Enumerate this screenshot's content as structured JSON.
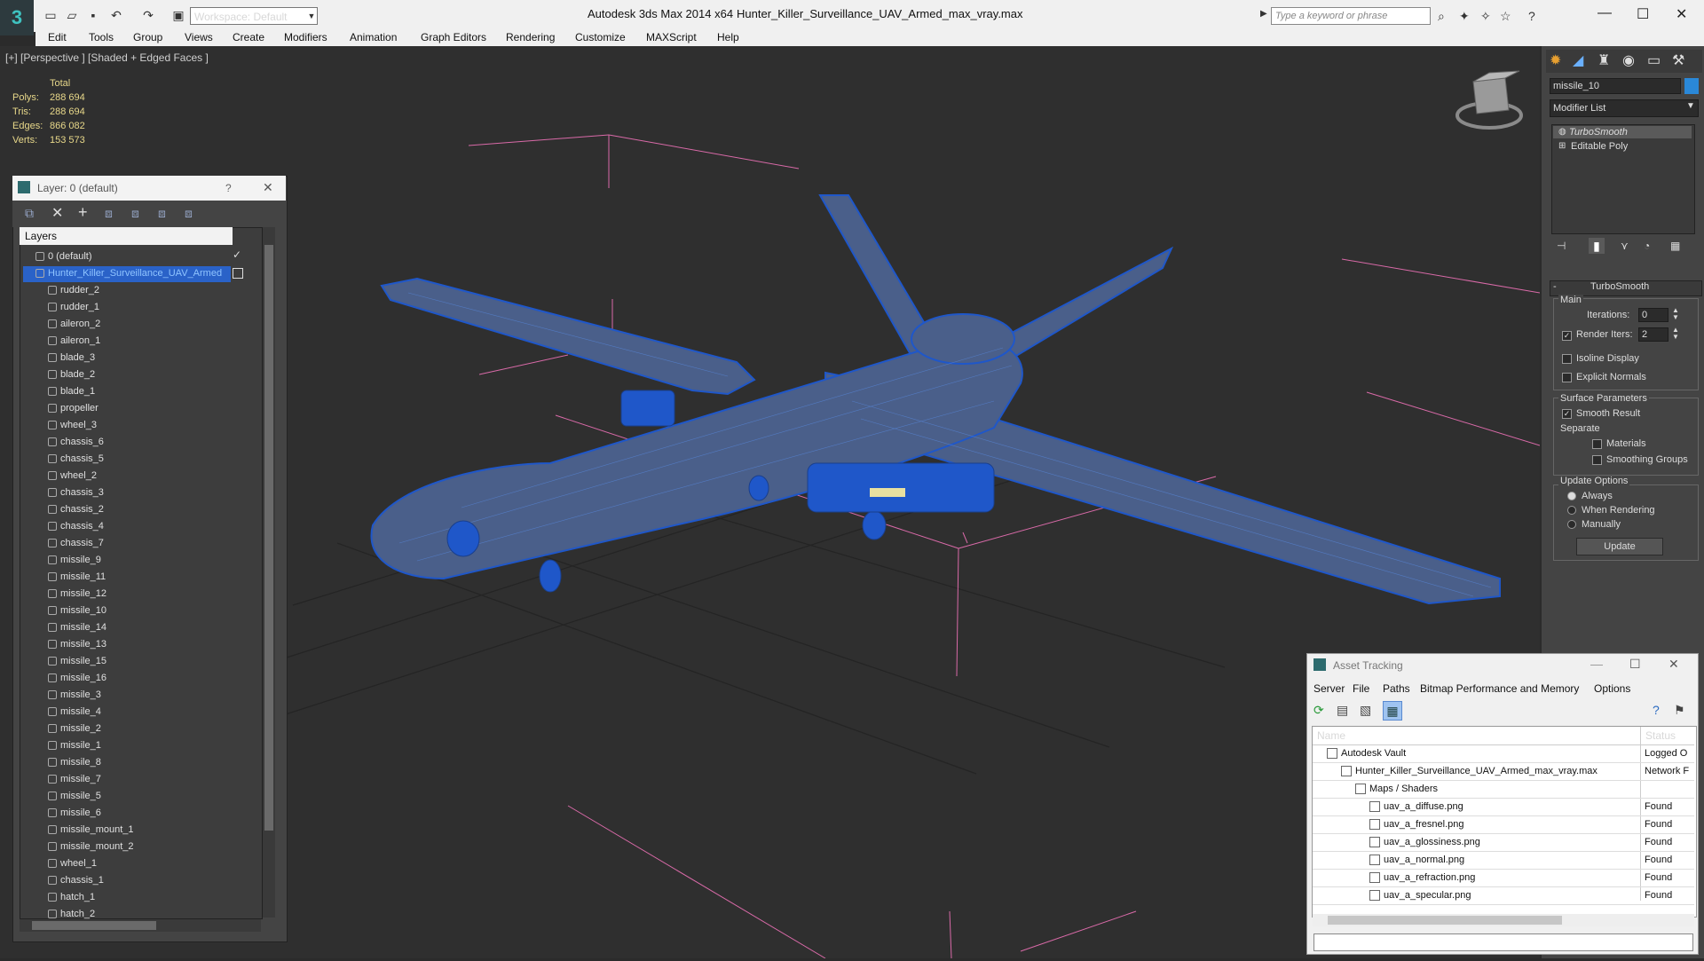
{
  "titlebar": {
    "workspace": "Workspace: Default",
    "app": "Autodesk 3ds Max  2014 x64",
    "file": "Hunter_Killer_Surveillance_UAV_Armed_max_vray.max",
    "search_placeholder": "Type a keyword or phrase"
  },
  "menus": [
    "Edit",
    "Tools",
    "Group",
    "Views",
    "Create",
    "Modifiers",
    "Animation",
    "Graph Editors",
    "Rendering",
    "Customize",
    "MAXScript",
    "Help"
  ],
  "viewport": {
    "label": "[+] [Perspective ] [Shaded + Edged Faces ]",
    "stats_header": "Total",
    "stats": [
      {
        "label": "Polys:",
        "value": "288 694"
      },
      {
        "label": "Tris:",
        "value": "288 694"
      },
      {
        "label": "Edges:",
        "value": "866 082"
      },
      {
        "label": "Verts:",
        "value": "153 573"
      }
    ]
  },
  "layer_panel": {
    "title": "Layer: 0 (default)",
    "header": "Layers",
    "help": "?",
    "rows": [
      "0 (default)",
      "Hunter_Killer_Surveillance_UAV_Armed",
      "rudder_2",
      "rudder_1",
      "aileron_2",
      "aileron_1",
      "blade_3",
      "blade_2",
      "blade_1",
      "propeller",
      "wheel_3",
      "chassis_6",
      "chassis_5",
      "wheel_2",
      "chassis_3",
      "chassis_2",
      "chassis_4",
      "chassis_7",
      "missile_9",
      "missile_11",
      "missile_12",
      "missile_10",
      "missile_14",
      "missile_13",
      "missile_15",
      "missile_16",
      "missile_3",
      "missile_4",
      "missile_2",
      "missile_1",
      "missile_8",
      "missile_7",
      "missile_5",
      "missile_6",
      "missile_mount_1",
      "missile_mount_2",
      "wheel_1",
      "chassis_1",
      "hatch_1",
      "hatch_2"
    ]
  },
  "command_panel": {
    "object_name": "missile_10",
    "modifier_list": "Modifier List",
    "stack": [
      "TurboSmooth",
      "Editable Poly"
    ],
    "rollout": "TurboSmooth",
    "main": "Main",
    "iterations_label": "Iterations:",
    "iterations": "0",
    "render_iters_label": "Render Iters:",
    "render_iters": "2",
    "isoline": "Isoline Display",
    "explicit": "Explicit Normals",
    "surface_params": "Surface Parameters",
    "smooth_result": "Smooth Result",
    "separate": "Separate",
    "materials": "Materials",
    "smoothing_groups": "Smoothing Groups",
    "update_options": "Update Options",
    "always": "Always",
    "when_rendering": "When Rendering",
    "manually": "Manually",
    "update_btn": "Update",
    "minus": "-"
  },
  "asset_tracking": {
    "title": "Asset Tracking",
    "menus": [
      "Server",
      "File",
      "Paths",
      "Bitmap Performance and Memory",
      "Options"
    ],
    "col_name": "Name",
    "col_status": "Status",
    "rows": [
      {
        "name": "Autodesk Vault",
        "status": "Logged O",
        "indent": 1
      },
      {
        "name": "Hunter_Killer_Surveillance_UAV_Armed_max_vray.max",
        "status": "Network F",
        "indent": 2
      },
      {
        "name": "Maps / Shaders",
        "status": "",
        "indent": 3
      },
      {
        "name": "uav_a_diffuse.png",
        "status": "Found",
        "indent": 4
      },
      {
        "name": "uav_a_fresnel.png",
        "status": "Found",
        "indent": 4
      },
      {
        "name": "uav_a_glossiness.png",
        "status": "Found",
        "indent": 4
      },
      {
        "name": "uav_a_normal.png",
        "status": "Found",
        "indent": 4
      },
      {
        "name": "uav_a_refraction.png",
        "status": "Found",
        "indent": 4
      },
      {
        "name": "uav_a_specular.png",
        "status": "Found",
        "indent": 4
      }
    ]
  }
}
